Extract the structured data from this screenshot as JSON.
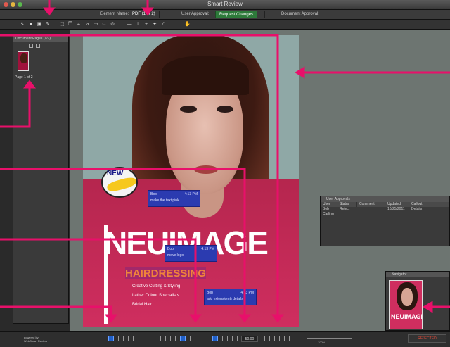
{
  "window": {
    "title": "Smart Review"
  },
  "status_bar": {
    "element_label": "Element Name:",
    "page_info": "PDF (1 of 2)",
    "user_approval_label": "User Approval:",
    "request_changes": "Request Changes",
    "document_approval_label": "Document Approval:"
  },
  "sidebar": {
    "header": "Document Pages (1/2)",
    "thumb_label": "Page 1 of 2"
  },
  "artwork": {
    "badge_text": "NEW",
    "brand": "NEUIMAGE",
    "hair_title": "HAIRDRESSING",
    "services": [
      "Creative Cutting & Styling",
      "Lather Colour Specialists",
      "Bridal Hair"
    ]
  },
  "notes": [
    {
      "author": "Bob",
      "time": "4:13 PM",
      "text": "make the text pink"
    },
    {
      "author": "Bob",
      "time": "4:13 PM",
      "text": "move logo"
    },
    {
      "author": "Bob",
      "time": "4:13 PM",
      "text": "add extension & details"
    }
  ],
  "rejects_panel": {
    "title": "User Approvals",
    "columns": [
      "User",
      "Status",
      "Comment",
      "Updated",
      "Callout"
    ],
    "rows": [
      [
        "Bob Carling",
        "Reject",
        "",
        "10/25/2011",
        "Details"
      ]
    ]
  },
  "navigator": {
    "title": "Navigator",
    "preview_text": "NEUIMAGE"
  },
  "bottom_bar": {
    "logo_line1": "powered by",
    "logo_line2": "WebSmart Review",
    "zoom": "50.00",
    "slider_value": "100%",
    "reject_label": "REJECTED"
  },
  "colors": {
    "callout": "#e8106a",
    "approve_green": "#2d7a3a",
    "note_blue": "#2b3bb0",
    "magenta_bg": "#cf2e5f"
  }
}
